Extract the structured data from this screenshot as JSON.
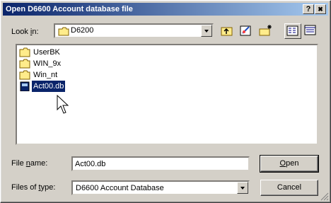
{
  "window": {
    "title": "Open D6600 Account database file",
    "help_button": "?",
    "close_button": "✖"
  },
  "lookin": {
    "label_pre": "Look ",
    "label_accel": "i",
    "label_post": "n:",
    "value": "D6200"
  },
  "files": [
    {
      "name": "UserBK",
      "type": "folder"
    },
    {
      "name": "WIN_9x",
      "type": "folder"
    },
    {
      "name": "Win_nt",
      "type": "folder"
    },
    {
      "name": "Act00.db",
      "type": "db",
      "selected": true
    }
  ],
  "filename": {
    "label_pre": "File ",
    "label_accel": "n",
    "label_post": "ame:",
    "value": "Act00.db"
  },
  "filetype": {
    "label_pre": "Files of ",
    "label_accel": "t",
    "label_post": "ype:",
    "value": "D6600 Account Database"
  },
  "buttons": {
    "open_accel": "O",
    "open_rest": "pen",
    "cancel": "Cancel"
  },
  "colors": {
    "titlebar_start": "#0a246a",
    "titlebar_end": "#a6caf0",
    "selection": "#0a246a",
    "face": "#d4d0c8"
  }
}
